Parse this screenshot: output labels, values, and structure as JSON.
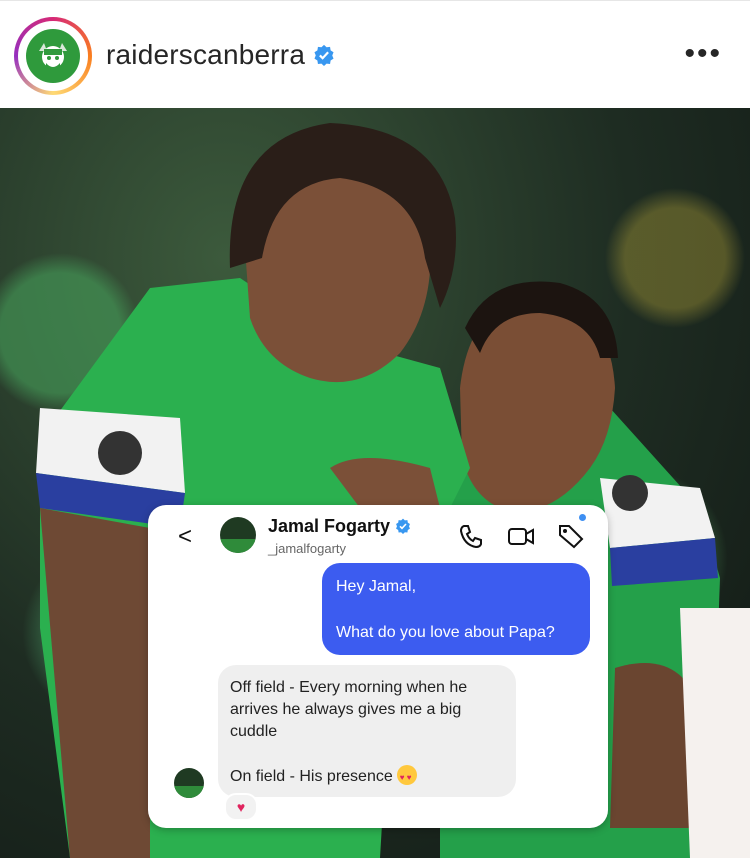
{
  "header": {
    "username": "raiderscanberra",
    "more_label": "•••"
  },
  "photo": {
    "description_hidden": ""
  },
  "chat": {
    "back_label": "<",
    "contact_name": "Jamal Fogarty",
    "contact_handle": "_jamalfogarty",
    "outgoing": {
      "line1": "Hey Jamal,",
      "line2": "What do you love about Papa?"
    },
    "incoming": {
      "line1": "Off field - Every morning when he",
      "line2": "arrives he always gives me a big",
      "line3": "cuddle",
      "line4": "On field - His presence"
    },
    "reaction": "♥"
  },
  "colors": {
    "accent_blue": "#3c5cf0",
    "verified": "#3897f0",
    "raiders_green": "#2f9a3c"
  }
}
